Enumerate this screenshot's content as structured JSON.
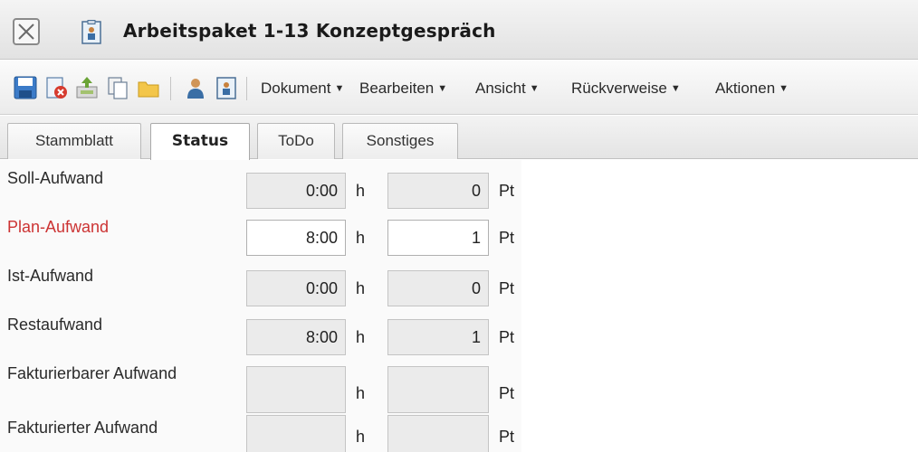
{
  "window": {
    "title": "Arbeitspaket 1-13 Konzeptgespräch",
    "close_icon": "close-icon",
    "doc_icon": "document-person-icon"
  },
  "toolbar": {
    "icons": [
      "save-icon",
      "delete-icon",
      "export-icon",
      "copy-icon",
      "folder-icon",
      "person-icon",
      "person-card-icon"
    ],
    "menus": [
      {
        "label": "Dokument"
      },
      {
        "label": "Bearbeiten"
      },
      {
        "label": "Ansicht"
      },
      {
        "label": "Rückverweise"
      },
      {
        "label": "Aktionen"
      }
    ]
  },
  "tabs": [
    {
      "label": "Stammblatt",
      "active": false
    },
    {
      "label": "Status",
      "active": true
    },
    {
      "label": "ToDo",
      "active": false
    },
    {
      "label": "Sonstiges",
      "active": false
    }
  ],
  "form": {
    "rows": [
      {
        "label": "Soll-Aufwand",
        "hours": "0:00",
        "hours_unit": "h",
        "points": "0",
        "points_unit": "Pt",
        "editable": false,
        "required": false
      },
      {
        "label": "Plan-Aufwand",
        "hours": "8:00",
        "hours_unit": "h",
        "points": "1",
        "points_unit": "Pt",
        "editable": true,
        "required": true
      },
      {
        "label": "Ist-Aufwand",
        "hours": "0:00",
        "hours_unit": "h",
        "points": "0",
        "points_unit": "Pt",
        "editable": false,
        "required": false
      },
      {
        "label": "Restaufwand",
        "hours": "8:00",
        "hours_unit": "h",
        "points": "1",
        "points_unit": "Pt",
        "editable": false,
        "required": false
      },
      {
        "label": "Fakturierbarer Aufwand",
        "hours": "",
        "hours_unit": "h",
        "points": "",
        "points_unit": "Pt",
        "editable": false,
        "required": false
      },
      {
        "label": "Fakturierter Aufwand",
        "hours": "",
        "hours_unit": "h",
        "points": "",
        "points_unit": "Pt",
        "editable": false,
        "required": false
      }
    ]
  },
  "colors": {
    "required_label": "#cc3333",
    "readonly_field": "#ebebeb",
    "editable_field": "#ffffff"
  }
}
